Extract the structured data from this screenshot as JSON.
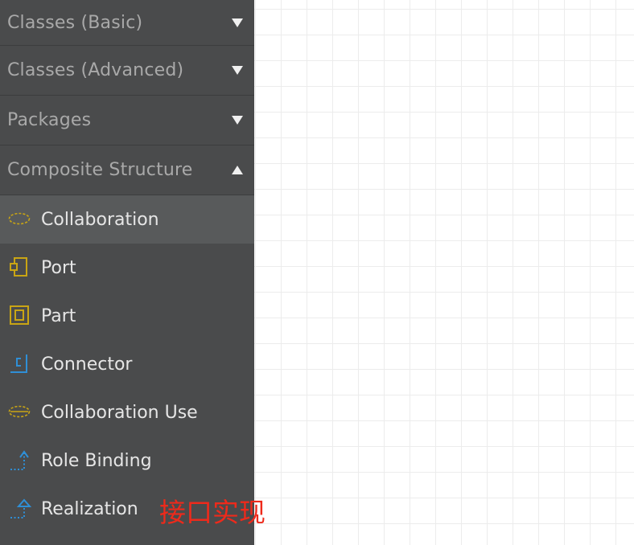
{
  "sections": [
    {
      "label": "Classes (Basic)",
      "state": "collapsed"
    },
    {
      "label": "Classes (Advanced)",
      "state": "collapsed"
    },
    {
      "label": "Packages",
      "state": "collapsed"
    },
    {
      "label": "Composite Structure",
      "state": "expanded"
    }
  ],
  "items": [
    {
      "label": "Collaboration",
      "icon": "collaboration-icon",
      "selected": true
    },
    {
      "label": "Port",
      "icon": "port-icon"
    },
    {
      "label": "Part",
      "icon": "part-icon"
    },
    {
      "label": "Connector",
      "icon": "connector-icon"
    },
    {
      "label": "Collaboration Use",
      "icon": "collaboration-use-icon"
    },
    {
      "label": "Role Binding",
      "icon": "role-binding-icon"
    },
    {
      "label": "Realization",
      "icon": "realization-icon"
    }
  ],
  "annotation": {
    "text": "接口实现",
    "color": "#ee2a1b"
  },
  "colors": {
    "sidebar": "#4a4b4c",
    "selected": "#585a5b",
    "icon_yellow": "#c9a514",
    "icon_blue": "#2f8fd6"
  }
}
